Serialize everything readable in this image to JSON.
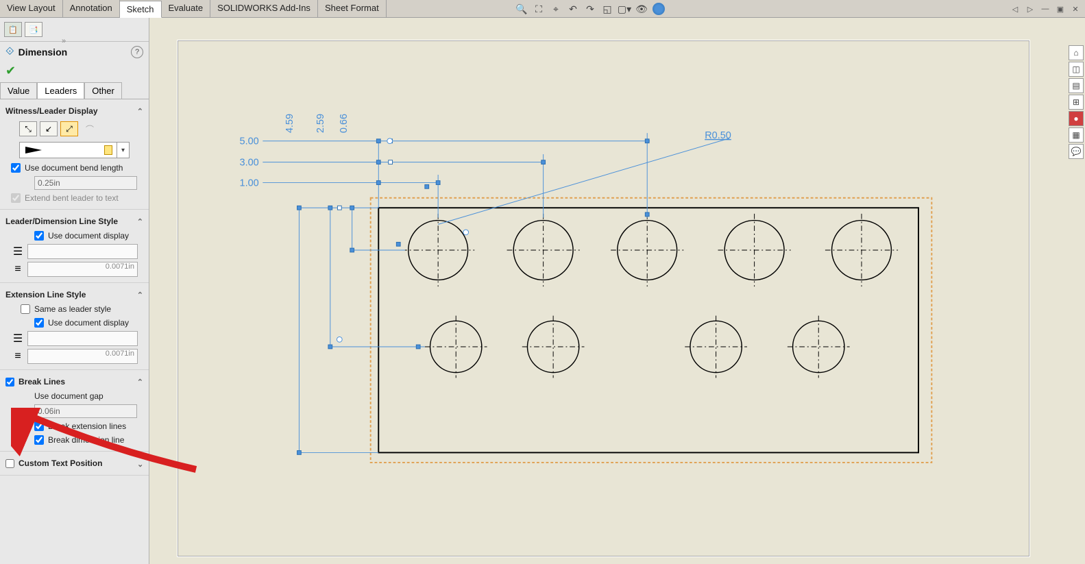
{
  "ribbon": {
    "tabs": [
      {
        "label": "View Layout"
      },
      {
        "label": "Annotation"
      },
      {
        "label": "Sketch",
        "active": true
      },
      {
        "label": "Evaluate"
      },
      {
        "label": "SOLIDWORKS Add-Ins"
      },
      {
        "label": "Sheet Format"
      }
    ]
  },
  "panel": {
    "title": "Dimension",
    "tabs": [
      {
        "label": "Value"
      },
      {
        "label": "Leaders",
        "active": true
      },
      {
        "label": "Other"
      }
    ],
    "witness": {
      "header": "Witness/Leader Display",
      "bend": {
        "label": "Use document bend length",
        "value": "0.25in",
        "checked": true
      },
      "extend": {
        "label": "Extend bent leader to text",
        "checked": true
      }
    },
    "leaderStyle": {
      "header": "Leader/Dimension Line Style",
      "display": {
        "label": "Use document display",
        "checked": true
      },
      "thickness": "0.0071in"
    },
    "extStyle": {
      "header": "Extension Line Style",
      "same": {
        "label": "Same as leader style",
        "checked": false
      },
      "display": {
        "label": "Use document display",
        "checked": true
      },
      "thickness": "0.0071in"
    },
    "breakLines": {
      "header": "Break Lines",
      "gap": {
        "label": "Use document gap",
        "value": "0.06in"
      },
      "ext": {
        "label": "Break extension lines",
        "checked": true
      },
      "dim": {
        "label": "Break dimension line",
        "checked": true
      }
    },
    "custom": {
      "header": "Custom Text Position"
    }
  },
  "dimensions": {
    "d500": "5.00",
    "d300": "3.00",
    "d100": "1.00",
    "r050": "R0.50",
    "v459": "4.59",
    "v259": "2.59",
    "v066": "0.66"
  }
}
